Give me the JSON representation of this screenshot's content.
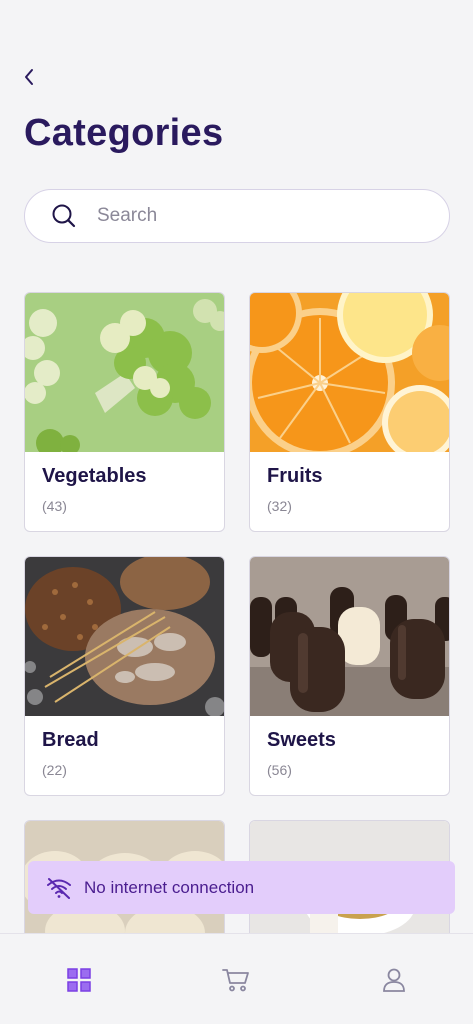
{
  "header": {
    "title": "Categories"
  },
  "search": {
    "placeholder": "Search"
  },
  "categories": [
    {
      "name": "Vegetables",
      "count": "(43)"
    },
    {
      "name": "Fruits",
      "count": "(32)"
    },
    {
      "name": "Bread",
      "count": "(22)"
    },
    {
      "name": "Sweets",
      "count": "(56)"
    },
    {
      "name": "",
      "count": ""
    },
    {
      "name": "",
      "count": ""
    }
  ],
  "toast": {
    "message": "No internet connection"
  },
  "tabbar": {
    "items": [
      {
        "icon": "grid-icon",
        "active": true
      },
      {
        "icon": "cart-icon",
        "active": false
      },
      {
        "icon": "profile-icon",
        "active": false
      }
    ]
  },
  "colors": {
    "accent": "#7b3fe4",
    "title": "#2a1a5e",
    "toast_bg": "#e3cdfb"
  }
}
